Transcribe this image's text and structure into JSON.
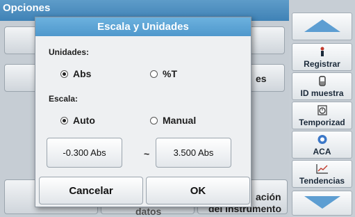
{
  "screen": {
    "title": "Opciones",
    "bg_text_es": "es",
    "bg_text_line1": "ación",
    "bg_text_line2": "del instrumento",
    "bg_text_datos": "datos"
  },
  "sidebar": {
    "up_icon": "arrow-up-icon",
    "items": [
      {
        "label": "Registrar",
        "icon": "person-icon"
      },
      {
        "label": "ID muestra",
        "icon": "vial-icon"
      },
      {
        "label": "Temporizad",
        "icon": "timer-icon"
      },
      {
        "label": "ACA",
        "icon": "aca-icon"
      },
      {
        "label": "Tendencias",
        "icon": "trend-icon"
      }
    ],
    "down_icon": "arrow-down-icon"
  },
  "dialog": {
    "title": "Escala y Unidades",
    "units_label": "Unidades:",
    "units_options": [
      {
        "label": "Abs",
        "selected": true
      },
      {
        "label": "%T",
        "selected": false
      }
    ],
    "scale_label": "Escala:",
    "scale_options": [
      {
        "label": "Auto",
        "selected": true
      },
      {
        "label": "Manual",
        "selected": false
      }
    ],
    "range_min": "-0.300 Abs",
    "range_separator": "~",
    "range_max": "3.500 Abs",
    "cancel_label": "Cancelar",
    "ok_label": "OK"
  },
  "colors": {
    "header_blue": "#4f98cc",
    "arrow_blue": "#5d9ed2"
  }
}
